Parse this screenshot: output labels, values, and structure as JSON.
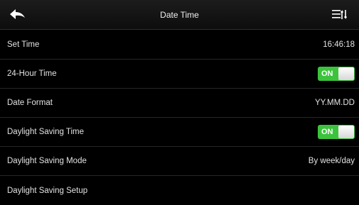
{
  "header": {
    "title": "Date Time",
    "back_icon": "back-arrow-icon",
    "menu_icon": "menu-sort-icon"
  },
  "rows": [
    {
      "label": "Set Time",
      "value": "16:46:18"
    },
    {
      "label": "24-Hour Time",
      "toggle": "ON"
    },
    {
      "label": "Date Format",
      "value": "YY.MM.DD"
    },
    {
      "label": "Daylight Saving Time",
      "toggle": "ON"
    },
    {
      "label": "Daylight Saving Mode",
      "value": "By week/day"
    },
    {
      "label": "Daylight Saving Setup"
    }
  ],
  "colors": {
    "background": "#000000",
    "toggle_on": "#3cc33c",
    "text": "#e2e2e2"
  }
}
